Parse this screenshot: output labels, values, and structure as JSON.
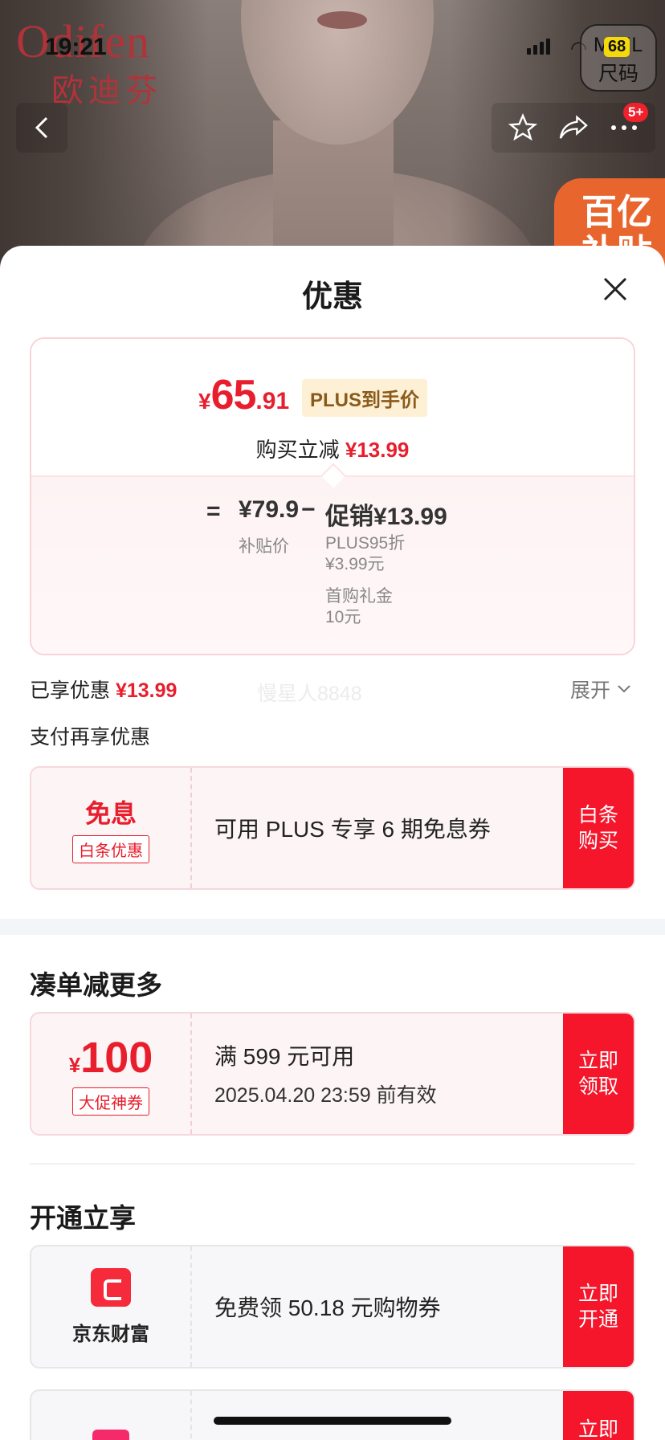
{
  "status": {
    "time": "19:21",
    "battery": "68"
  },
  "brand": {
    "name_en": "Odifen",
    "name_cn": "欧迪芬"
  },
  "size_bubble": {
    "size": "M  XL",
    "label": "尺码"
  },
  "nav": {
    "badge": "5+"
  },
  "subsidy_banner": {
    "text": "百亿 补贴"
  },
  "sheet": {
    "title": "优惠",
    "price": {
      "currency": "¥",
      "integer": "65",
      "decimal": ".91",
      "tag": "PLUS到手价",
      "instant_label": "购买立减",
      "instant_amount": "¥13.99"
    },
    "formula": {
      "eq": "=",
      "base": "¥79.9",
      "base_label": "补贴价",
      "minus": "−",
      "promo": "促销¥13.99",
      "details": [
        {
          "l1": "PLUS95折",
          "l2": "¥3.99元"
        },
        {
          "l1": "首购礼金",
          "l2": "10元"
        }
      ]
    },
    "enjoyed_label": "已享优惠",
    "enjoyed_amount": "¥13.99",
    "watermark": "慢星人8848",
    "expand_label": "展开",
    "pay_more_label": "支付再享优惠",
    "baitiao": {
      "title": "免息",
      "tag": "白条优惠",
      "text": "可用 PLUS 专享 6 期免息券",
      "button": "白条购买"
    },
    "more": {
      "title": "凑单减更多",
      "coupon": {
        "currency": "¥",
        "amount": "100",
        "tag": "大促神券",
        "condition": "满 599 元可用",
        "expiry": "2025.04.20 23:59 前有效",
        "button": "立即领取"
      }
    },
    "open": {
      "title": "开通立享",
      "items": [
        {
          "brand": "京东财富",
          "text": "免费领 50.18 元购物券",
          "button": "立即开通"
        },
        {
          "brand": "",
          "text": "",
          "button": "立即"
        }
      ]
    }
  },
  "colors": {
    "accent": "#e81e2d",
    "button": "#f5162c",
    "plus_tag_bg": "#fdf0d5"
  }
}
